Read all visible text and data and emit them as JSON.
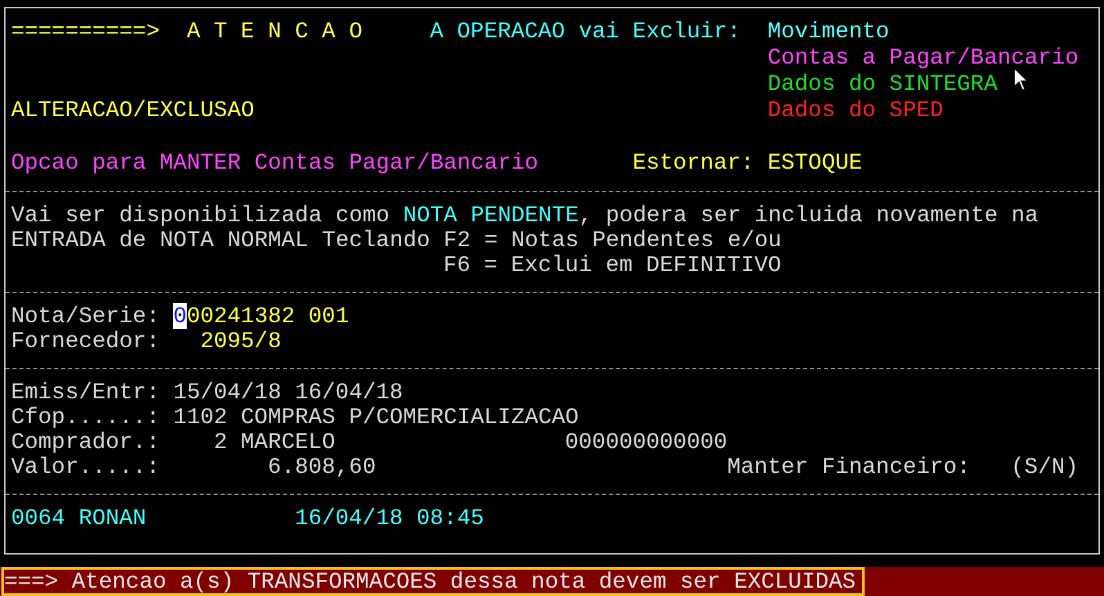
{
  "header": {
    "arrow": "==========>",
    "title": "A T E N C A O",
    "operation_label": "A OPERACAO vai Excluir:",
    "items": [
      {
        "text": "Movimento",
        "color": "#55ffff"
      },
      {
        "text": "Contas a Pagar/Bancario",
        "color": "#ff44ff"
      },
      {
        "text": "Dados do SINTEGRA",
        "color": "#22dd22"
      },
      {
        "text": "Dados do SPED",
        "color": "#ff2020"
      }
    ],
    "mode": "ALTERACAO/EXCLUSAO",
    "option": "Opcao para MANTER Contas Pagar/Bancario",
    "reverse_label": "Estornar:",
    "reverse_value": "ESTOQUE"
  },
  "message": {
    "before": "Vai ser disponibilizada como ",
    "highlight": "NOTA PENDENTE",
    "after": ", podera ser incluida novamente na",
    "line_2": "ENTRADA de NOTA NORMAL Teclando F2 = Notas Pendentes e/ou",
    "line_3": "F6 = Exclui em DEFINITIVO"
  },
  "invoice": {
    "number_label": "Nota/Serie:",
    "number": "000241382 001",
    "cursor_at_start": true,
    "supplier_label": "Fornecedor:",
    "supplier": "2095/8"
  },
  "details": {
    "dates_label": "Emiss/Entr:",
    "dates": "15/04/18 16/04/18",
    "cfop_label": "Cfop......:",
    "cfop": "1102 COMPRAS P/COMERCIALIZACAO",
    "buyer_label": "Comprador.:",
    "buyer": "2 MARCELO",
    "buyer_code": "000000000000",
    "value_label": "Valor.....:",
    "value": "6.808,60",
    "keep_label": "Manter Financeiro:",
    "keep_options": "(S/N)"
  },
  "footer": {
    "user": "0064 RONAN",
    "datetime": "16/04/18 08:45"
  },
  "status_bar": {
    "text": "===> Atencao a(s) TRANSFORMACOES dessa nota devem ser EXCLUIDAS"
  }
}
